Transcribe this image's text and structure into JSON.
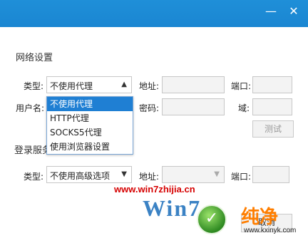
{
  "window": {
    "minimize": "—",
    "close": "✕"
  },
  "network": {
    "section_title": "网络设置",
    "type_label": "类型:",
    "type_selected": "不使用代理",
    "address_label": "地址:",
    "port_label": "端口:",
    "username_label": "用户名:",
    "password_label": "密码:",
    "domain_label": "域:",
    "test_button": "测试",
    "options": [
      "不使用代理",
      "HTTP代理",
      "SOCKS5代理",
      "使用浏览器设置"
    ]
  },
  "login": {
    "section_title": "登录服务",
    "type_label": "类型:",
    "type_selected": "不使用高级选项",
    "address_label": "地址:",
    "port_label": "端口:"
  },
  "footer": {
    "cancel_button": "取消"
  },
  "watermark": {
    "url": "www.win7zhijia.cn",
    "logo_text": "Win7",
    "logo2": "纯净",
    "site": "www.kxinyk.com"
  }
}
